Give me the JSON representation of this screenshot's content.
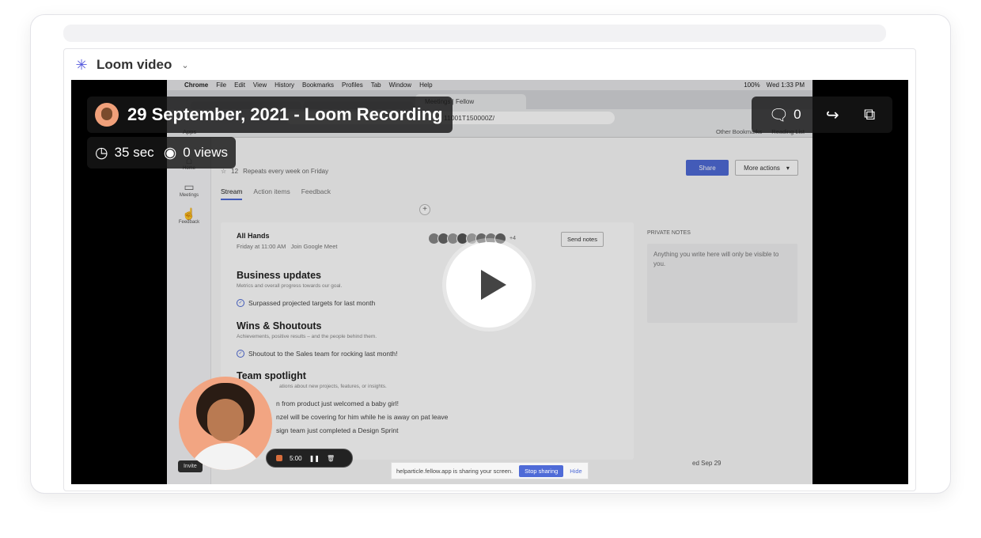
{
  "embed": {
    "title": "Loom video"
  },
  "video": {
    "title": "29 September, 2021 - Loom Recording",
    "duration": "35 sec",
    "views": "0 views",
    "comments_count": "0"
  },
  "screen": {
    "menubar": {
      "app": "Chrome",
      "items": [
        "File",
        "Edit",
        "View",
        "History",
        "Bookmarks",
        "Profiles",
        "Tab",
        "Window",
        "Help"
      ],
      "battery": "100%",
      "clock": "Wed 1:33 PM"
    },
    "tab_active": "Meetings | Fellow",
    "url_fragment": "11001T150000Z/",
    "bookmarks": {
      "left": "Apps",
      "right1": "Other Bookmarks",
      "right2": "Reading List"
    },
    "nav": [
      {
        "label": "Home"
      },
      {
        "label": "Meetings"
      },
      {
        "label": "Feedback"
      }
    ],
    "invite": "Invite",
    "repeat_count": "12",
    "repeat_text": "Repeats every week on Friday",
    "share_label": "Share",
    "more_actions_label": "More actions",
    "subtabs": [
      "Stream",
      "Action items",
      "Feedback"
    ],
    "meeting": {
      "title": "All Hands",
      "time": "Friday at 11:00 AM",
      "join": "Join Google Meet",
      "avatars_more": "+4",
      "send_notes": "Send notes"
    },
    "sections": [
      {
        "heading": "Business updates",
        "sub": "Metrics and overall progress towards our goal.",
        "item": "Surpassed projected targets for last month"
      },
      {
        "heading": "Wins & Shoutouts",
        "sub": "Achievements, positive results – and the people behind them.",
        "item": "Shoutout to the Sales team for rocking last month!"
      },
      {
        "heading": "Team spotlight",
        "sub": "ations about new projects, features, or insights.",
        "items": [
          "n from product just welcomed a baby girl!",
          "nzel will be covering for him while he is away on pat leave",
          "sign team just completed a Design Sprint"
        ]
      }
    ],
    "private_notes_label": "PRIVATE NOTES",
    "private_notes_placeholder": "Anything you write here will only be visible to you.",
    "recorder_time": "5:00",
    "sharing_text": "helparticle.fellow.app is sharing your screen.",
    "stop_sharing": "Stop sharing",
    "hide": "Hide",
    "date_bit": "ed Sep 29"
  }
}
